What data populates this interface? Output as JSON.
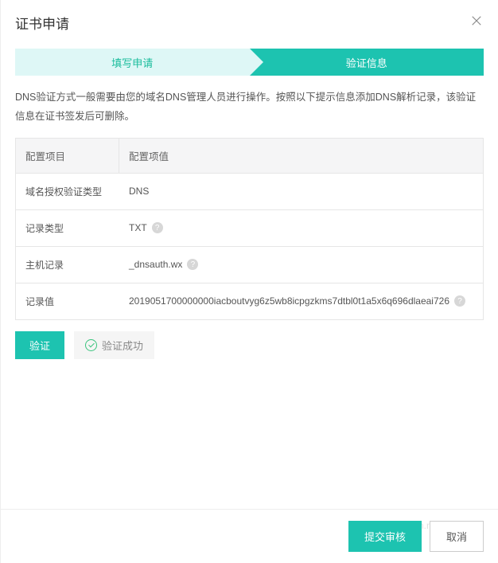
{
  "modal": {
    "title": "证书申请"
  },
  "steps": {
    "fill": "填写申请",
    "verify": "验证信息"
  },
  "description": "DNS验证方式一般需要由您的域名DNS管理人员进行操作。按照以下提示信息添加DNS解析记录，该验证信息在证书签发后可删除。",
  "table": {
    "header_item": "配置项目",
    "header_value": "配置项值",
    "rows": [
      {
        "label": "域名授权验证类型",
        "value": "DNS",
        "help": false
      },
      {
        "label": "记录类型",
        "value": "TXT",
        "help": true
      },
      {
        "label": "主机记录",
        "value": "_dnsauth.wx",
        "help": true
      },
      {
        "label": "记录值",
        "value": "2019051700000000iacboutvyg6z5wb8icpgzkms7dtbl0t1a5x6q696dlaeai726",
        "help": true
      }
    ]
  },
  "actions": {
    "verify_btn": "验证",
    "success_text": "验证成功"
  },
  "footer": {
    "submit": "提交审核",
    "cancel": "取消"
  },
  "watermark": "https://blog.csdn.net/cxh_1231"
}
